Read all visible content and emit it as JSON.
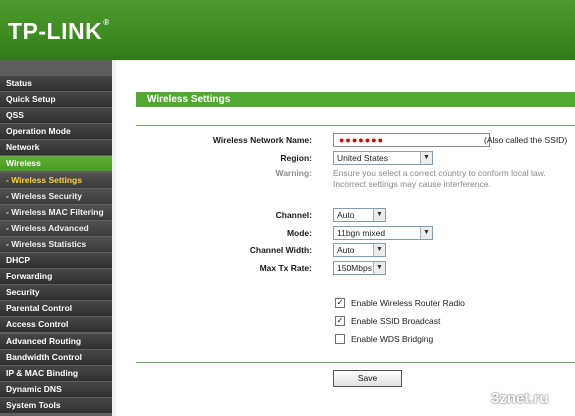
{
  "brand": {
    "logo_text": "TP-LINK",
    "reg_mark": "®",
    "header_color": "#3f8c22"
  },
  "sidebar": {
    "items": [
      {
        "label": "Status",
        "type": "main"
      },
      {
        "label": "Quick Setup",
        "type": "main"
      },
      {
        "label": "QSS",
        "type": "main"
      },
      {
        "label": "Operation Mode",
        "type": "main"
      },
      {
        "label": "Network",
        "type": "main"
      },
      {
        "label": "Wireless",
        "type": "main",
        "active": true
      },
      {
        "label": "- Wireless Settings",
        "type": "sub",
        "current": true
      },
      {
        "label": "- Wireless Security",
        "type": "sub"
      },
      {
        "label": "- Wireless MAC Filtering",
        "type": "sub"
      },
      {
        "label": "- Wireless Advanced",
        "type": "sub"
      },
      {
        "label": "- Wireless Statistics",
        "type": "sub"
      },
      {
        "label": "DHCP",
        "type": "main"
      },
      {
        "label": "Forwarding",
        "type": "main"
      },
      {
        "label": "Security",
        "type": "main"
      },
      {
        "label": "Parental Control",
        "type": "main"
      },
      {
        "label": "Access Control",
        "type": "main"
      },
      {
        "label": "Advanced Routing",
        "type": "main"
      },
      {
        "label": "Bandwidth Control",
        "type": "main"
      },
      {
        "label": "IP & MAC Binding",
        "type": "main"
      },
      {
        "label": "Dynamic DNS",
        "type": "main"
      },
      {
        "label": "System Tools",
        "type": "main"
      }
    ]
  },
  "main": {
    "section_title": "Wireless Settings",
    "ssid": {
      "label": "Wireless Network Name:",
      "value": "●●●●●●●",
      "note": "(Also called the SSID)"
    },
    "region": {
      "label": "Region:",
      "value": "United States"
    },
    "warning": {
      "label": "Warning:",
      "text": "Ensure you select a correct country to conform local law. Incorrect settings may cause interference."
    },
    "channel": {
      "label": "Channel:",
      "value": "Auto"
    },
    "mode": {
      "label": "Mode:",
      "value": "11bgn mixed"
    },
    "channel_width": {
      "label": "Channel Width:",
      "value": "Auto"
    },
    "max_tx_rate": {
      "label": "Max Tx Rate:",
      "value": "150Mbps"
    },
    "options": [
      {
        "label": "Enable Wireless Router Radio",
        "checked": true,
        "mark": "✓"
      },
      {
        "label": "Enable SSID Broadcast",
        "checked": true,
        "mark": "✓"
      },
      {
        "label": "Enable WDS Bridging",
        "checked": false,
        "mark": ""
      }
    ],
    "save_label": "Save"
  },
  "watermark": "3znet.ru"
}
